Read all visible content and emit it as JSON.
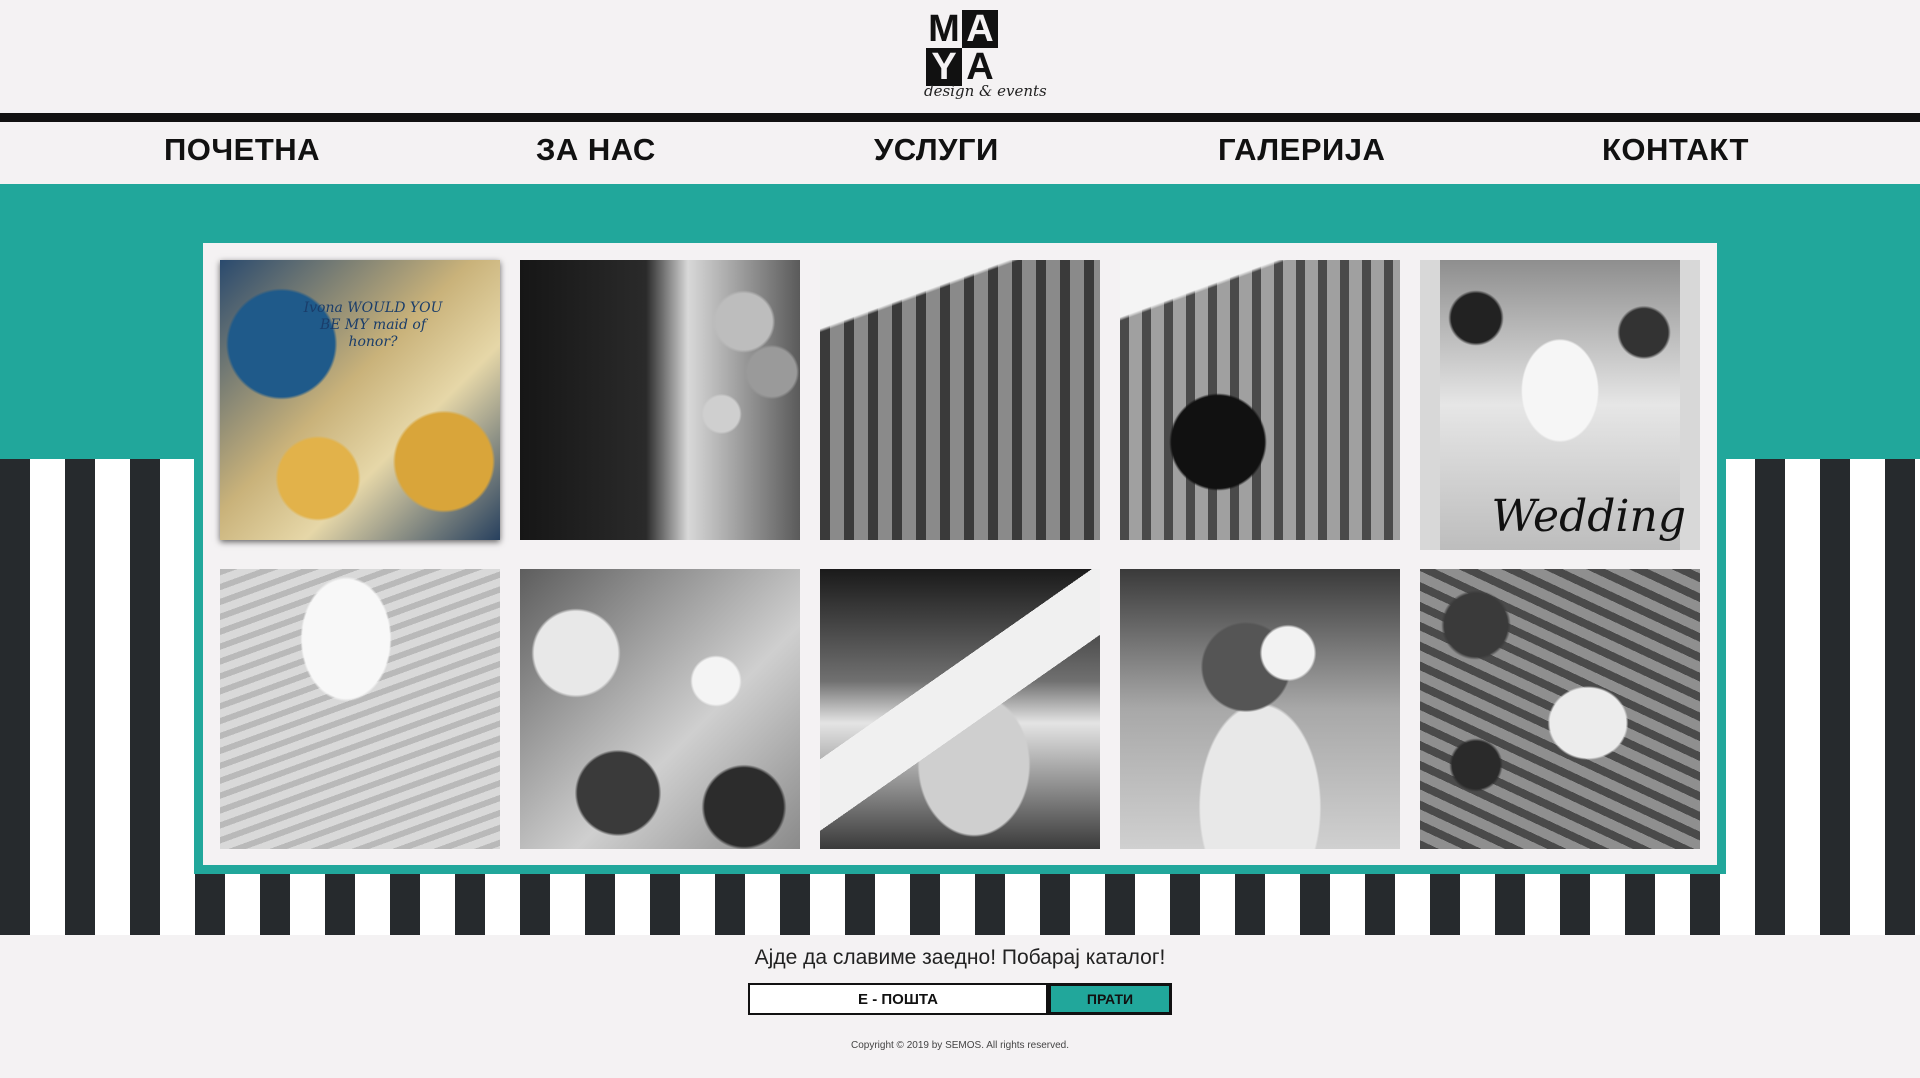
{
  "brand": {
    "logo_letters": [
      "M",
      "A",
      "Y",
      "A"
    ],
    "logo_tagline": "design & events"
  },
  "nav": {
    "items": [
      {
        "label": "ПОЧЕТНА"
      },
      {
        "label": "ЗА НАС"
      },
      {
        "label": "УСЛУГИ"
      },
      {
        "label": "ГАЛЕРИЈА"
      },
      {
        "label": "КОНТАКТ"
      }
    ]
  },
  "gallery": {
    "items": [
      {
        "subject": "bridesmaid proposal cards",
        "card_text": "Ivona WOULD YOU BE MY maid of honor?"
      },
      {
        "subject": "balloon arch photo booth"
      },
      {
        "subject": "building with postcard"
      },
      {
        "subject": "building with illustrated card"
      },
      {
        "subject": "wedding table decoration",
        "caption": "Wedding"
      },
      {
        "subject": "gift box with ribbon"
      },
      {
        "subject": "sunflowers and candles centerpiece"
      },
      {
        "subject": "gift box set"
      },
      {
        "subject": "flower arrangement with candles"
      },
      {
        "subject": "welcome sign with candles"
      }
    ]
  },
  "footer": {
    "cta": "Ајде да славиме заедно! Побарај каталог!",
    "email_placeholder": "Е - ПОШТА",
    "send_label": "ПРАТИ",
    "copyright": "Copyright © 2019 by SEMOS. All rights reserved."
  },
  "colors": {
    "accent": "#21a79b",
    "dark": "#111111",
    "background": "#f4f2f3",
    "stripe_dark": "#262a2d"
  }
}
